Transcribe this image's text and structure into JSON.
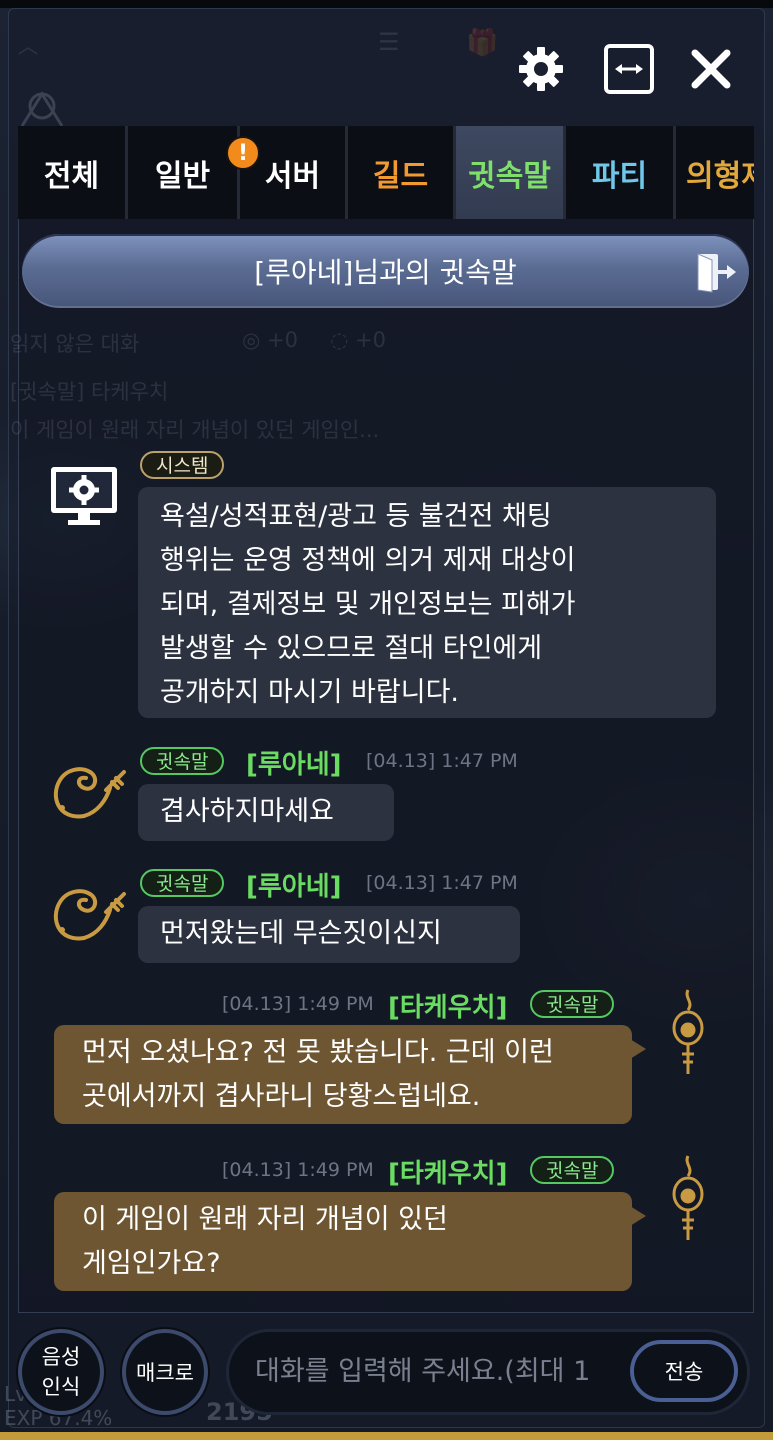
{
  "background": {
    "ghost_header_title": "",
    "ghost_unread": "읽지 않은 대화",
    "ghost_counter_a": "+0",
    "ghost_counter_b": "+0",
    "ghost_preview_name": "[귓속말] 타케우치",
    "ghost_preview_text": "이 게임이 원래 자리 개념이 있던 게임인...",
    "ghost_level": "Lv",
    "ghost_exp": "EXP 67.4%",
    "ghost_number": "2195"
  },
  "toolbar": {
    "settings_icon": "gear-icon",
    "resize_icon": "horizontal-resize-icon",
    "close_icon": "close-icon"
  },
  "tabs": [
    {
      "label": "전체",
      "color": "#ffffff"
    },
    {
      "label": "일반",
      "color": "#ffffff"
    },
    {
      "label": "서버",
      "color": "#ffffff",
      "badge": "!"
    },
    {
      "label": "길드",
      "color": "#f29a2f"
    },
    {
      "label": "귓속말",
      "color": "#7ee06a",
      "active": true
    },
    {
      "label": "파티",
      "color": "#6fc7ea"
    },
    {
      "label": "의형제",
      "color": "#e3a83a"
    }
  ],
  "whisper_header": {
    "title": "[루아네]님과의 귓속말",
    "exit_icon": "exit-door-icon"
  },
  "messages": [
    {
      "tag": "시스템",
      "text_lines": [
        "욕설/성적표현/광고 등 불건전 채팅",
        "행위는 운영 정책에 의거 제재 대상이",
        "되며, 결제정보 및 개인정보는 피해가",
        "발생할 수 있으므로 절대 타인에게",
        "공개하지 마시기 바랍니다."
      ],
      "icon": "system-monitor-gear-icon"
    },
    {
      "tag": "귓속말",
      "name": "[루아네]",
      "time": "[04.13] 1:47 PM",
      "text": "겹사하지마세요",
      "icon": "scorpion-class-icon"
    },
    {
      "tag": "귓속말",
      "name": "[루아네]",
      "time": "[04.13] 1:47 PM",
      "text": "먼저왔는데 무슨짓이신지",
      "icon": "scorpion-class-icon"
    },
    {
      "tag": "귓속말",
      "name": "[타케우치]",
      "time": "[04.13] 1:49 PM",
      "text_lines": [
        "먼저 오셨나요? 전 못 봤습니다. 근데 이런",
        "곳에서까지 겹사라니 당황스럽네요."
      ],
      "icon": "flame-class-icon"
    },
    {
      "tag": "귓속말",
      "name": "[타케우치]",
      "time": "[04.13] 1:49 PM",
      "text_lines": [
        "이 게임이 원래 자리 개념이 있던",
        "게임인가요?"
      ],
      "icon": "flame-class-icon"
    }
  ],
  "input_bar": {
    "voice_line1": "음성",
    "voice_line2": "인식",
    "macro_label": "매크로",
    "placeholder": "대화를 입력해 주세요.(최대 1",
    "send_label": "전송"
  },
  "colors": {
    "whisper_green": "#6bdc62",
    "my_bubble": "#6e5632",
    "other_bubble": "#2c3240",
    "accent_blue": "#4a5f94"
  }
}
